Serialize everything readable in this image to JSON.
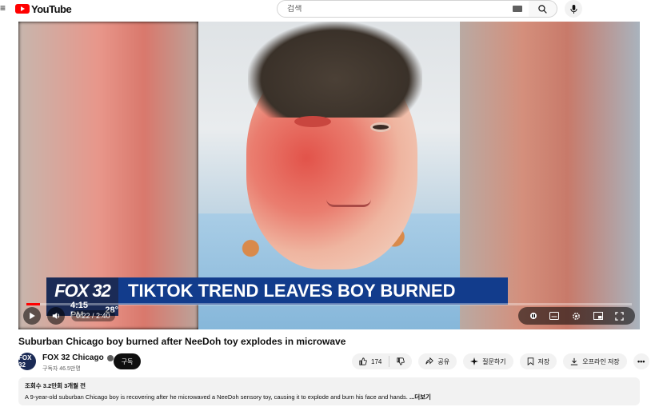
{
  "app": {
    "logo_text": "YouTube",
    "brand_color": "#ff0000"
  },
  "search": {
    "placeholder": "검색",
    "icons": [
      "keyboard-icon",
      "search-icon",
      "mic-icon"
    ]
  },
  "player": {
    "banner_logo": "FOX 32",
    "banner_headline": "TIKTOK TREND LEAVES BOY BURNED",
    "banner_time": "4:15 PM",
    "banner_temp": "28°",
    "time_display": "0:22 / 2:40",
    "progress": 0.023,
    "right_icons": [
      "pause-icon",
      "subtitles-icon",
      "settings-icon",
      "miniplayer-icon",
      "fullscreen-icon"
    ]
  },
  "video": {
    "title": "Suburban Chicago boy burned after NeeDoh toy explodes in microwave"
  },
  "channel": {
    "avatar_text": "FOX 32",
    "name": "FOX 32 Chicago",
    "subscribers": "구독자 46.5만명",
    "subscribe_label": "구독"
  },
  "actions": {
    "like_count": "174",
    "share_label": "공유",
    "ask_label": "질문하기",
    "save_label": "저장",
    "offline_save_label": "오프라인 저장",
    "more_label": "•••"
  },
  "description": {
    "meta": "조회수 3.2만회  3개월 전",
    "text": "A 9-year-old suburban Chicago boy is recovering after he microwaved a NeeDoh sensory toy, causing it to explode and burn his face and hands. ",
    "more_label": "...더보기"
  }
}
